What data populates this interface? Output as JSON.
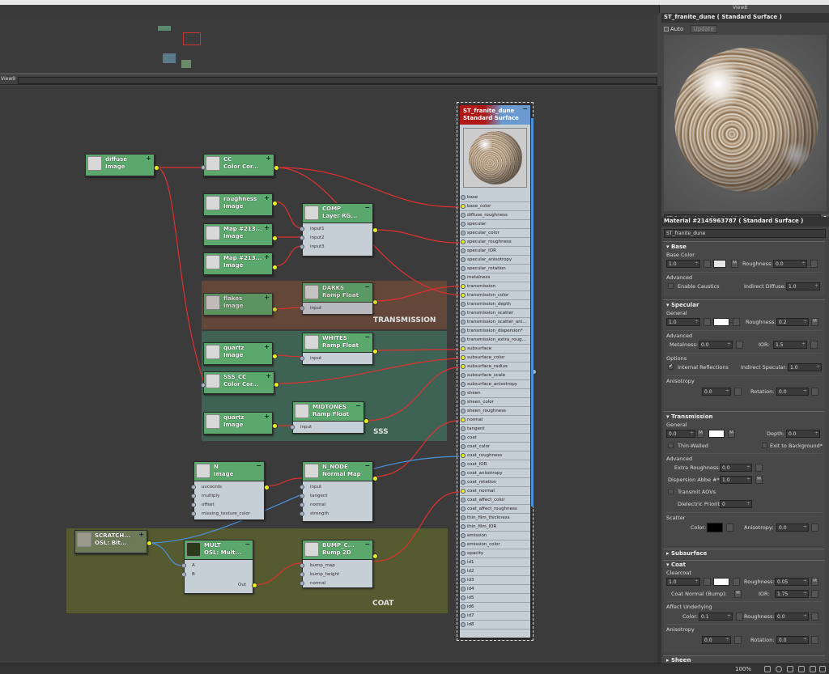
{
  "window": {
    "view_tab": "View8",
    "nav_view_label": "View9"
  },
  "preview": {
    "title": "ST_franite_dune  ( Standard Surface )",
    "auto_label": "Auto",
    "update_label": "Update",
    "name_field": "ST_franite_dune  ( Standard Surface )"
  },
  "props": {
    "title": "Material #2145963787  ( Standard Surface )",
    "material_name": "ST_franite_dune",
    "base": {
      "header": "Base",
      "color_label": "Base Color",
      "weight": "1.0",
      "m": "M",
      "roughness_label": "Roughness:",
      "roughness": "0.0",
      "advanced": "Advanced",
      "caustics": "Enable Caustics",
      "indirect_diffuse_label": "Indirect Diffuse:",
      "indirect_diffuse": "1.0"
    },
    "specular": {
      "header": "Specular",
      "general": "General",
      "weight": "1.0",
      "roughness_label": "Roughness:",
      "roughness": "0.2",
      "m": "M",
      "advanced": "Advanced",
      "metalness_label": "Metalness:",
      "metalness": "0.0",
      "ior_label": "IOR:",
      "ior": "1.5",
      "options": "Options",
      "internal_reflections": "Internal Reflections",
      "indirect_specular_label": "Indirect Specular:",
      "indirect_specular": "1.0",
      "anisotropy": "Anisotropy",
      "aniso_value": "0.0",
      "rotation_label": "Rotation:",
      "rotation": "0.0"
    },
    "transmission": {
      "header": "Transmission",
      "general": "General",
      "weight": "0.0",
      "m1": "M",
      "m2": "M",
      "depth_label": "Depth:",
      "depth": "0.0",
      "thin_walled": "Thin-Walled",
      "exit_bg": "Exit to Background*",
      "advanced": "Advanced",
      "extra_rough_label": "Extra Roughness:",
      "extra_rough": "0.0",
      "dispersion_label": "Dispersion Abbe #*:",
      "dispersion": "1.0",
      "m3": "M",
      "transmit_aovs": "Transmit AOVs",
      "dielectric_label": "Dielectric Priority",
      "dielectric": "0",
      "scatter": "Scatter",
      "color_label": "Color:",
      "anisotropy_label": "Anisotropy:",
      "anisotropy": "0.0"
    },
    "subsurface": {
      "header": "Subsurface"
    },
    "coat": {
      "header": "Coat",
      "clearcoat": "Clearcoat",
      "weight": "1.0",
      "roughness_label": "Roughness:",
      "roughness": "0.05",
      "m": "M",
      "normal_label": "Coat Normal (Bump):",
      "m2": "M",
      "ior_label": "IOR:",
      "ior": "1.75",
      "affect": "Affect Underlying",
      "color_label": "Color:",
      "color": "0.1",
      "rough2_label": "Roughness:",
      "rough2": "0.0",
      "anisotropy": "Anisotropy",
      "aniso": "0.0",
      "rotation_label": "Rotation:",
      "rotation": "0.0"
    },
    "sheen": {
      "header": "Sheen"
    }
  },
  "nodes": {
    "diffuse": {
      "t1": "diffuse",
      "t2": "Image"
    },
    "cc": {
      "t1": "CC",
      "t2": "Color Cor..."
    },
    "roughness": {
      "t1": "roughness",
      "t2": "Image"
    },
    "map1": {
      "t1": "Map #213...",
      "t2": "Image"
    },
    "map2": {
      "t1": "Map #213...",
      "t2": "Image"
    },
    "comp": {
      "t1": "COMP",
      "t2": "Layer RG...",
      "ports": [
        "input1",
        "input2",
        "input3"
      ]
    },
    "flakes": {
      "t1": "flakes",
      "t2": "Image"
    },
    "darks": {
      "t1": "DARKS",
      "t2": "Ramp Float",
      "ports": [
        "input"
      ]
    },
    "quartz1": {
      "t1": "quartz",
      "t2": "Image"
    },
    "whites": {
      "t1": "WHITES",
      "t2": "Ramp Float",
      "ports": [
        "input"
      ]
    },
    "sss_cc": {
      "t1": "SSS_CC",
      "t2": "Color Cor..."
    },
    "quartz2": {
      "t1": "quartz",
      "t2": "Image"
    },
    "midtones": {
      "t1": "MIDTONES",
      "t2": "Ramp Float",
      "ports": [
        "input"
      ]
    },
    "n": {
      "t1": "N",
      "t2": "Image",
      "ports": [
        "uvcoords",
        "multiply",
        "offset",
        "missing_texture_color"
      ]
    },
    "n_node": {
      "t1": "N_NODE",
      "t2": "Normal Map",
      "ports": [
        "input",
        "tangent",
        "normal",
        "strength"
      ]
    },
    "scratch": {
      "t1": "SCRATCH...",
      "t2": "OSL: Bit..."
    },
    "mult": {
      "t1": "MULT",
      "t2": "OSL: Mult...",
      "ports": [
        "A",
        "B"
      ],
      "out": "Out"
    },
    "bump": {
      "t1": "BUMP_C...",
      "t2": "Bump 2D",
      "ports": [
        "bump_map",
        "bump_height",
        "normal"
      ]
    },
    "main": {
      "t1": "ST_franite_dune",
      "t2": "Standard Surface"
    }
  },
  "zones": {
    "transmission": "TRANSMISSION",
    "sss": "SSS",
    "coat": "COAT"
  },
  "main_ports": [
    "base",
    "base_color",
    "diffuse_roughness",
    "specular",
    "specular_color",
    "specular_roughness",
    "specular_IOR",
    "specular_anisotropy",
    "specular_rotation",
    "metalness",
    "transmission",
    "transmission_color",
    "transmission_depth",
    "transmission_scatter",
    "transmission_scatter_ani...",
    "transmission_dispersion*",
    "transmission_extra_roug...",
    "subsurface",
    "subsurface_color",
    "subsurface_radius",
    "subsurface_scale",
    "subsurface_anisotropy",
    "sheen",
    "sheen_color",
    "sheen_roughness",
    "normal",
    "tangent",
    "coat",
    "coat_color",
    "coat_roughness",
    "coat_IOR",
    "coat_anisotropy",
    "coat_rotation",
    "coat_normal",
    "coat_affect_color",
    "coat_affect_roughness",
    "thin_film_thickness",
    "thin_film_IOR",
    "emission",
    "emission_color",
    "opacity",
    "id1",
    "id2",
    "id3",
    "id4",
    "id5",
    "id6",
    "id7",
    "id8"
  ],
  "connected_ports": [
    "base_color",
    "specular_roughness",
    "transmission",
    "transmission_color",
    "subsurface",
    "subsurface_color",
    "subsurface_radius",
    "normal",
    "coat_roughness",
    "coat_normal"
  ],
  "status": {
    "zoom": "100%"
  },
  "colors": {
    "node_header": "#5aa86c",
    "wire_red": "#e03030",
    "wire_blue": "#4a90d8",
    "zone_transmission": "#6b4a3a",
    "zone_sss": "#3f6a58",
    "zone_coat": "#5b6030"
  }
}
